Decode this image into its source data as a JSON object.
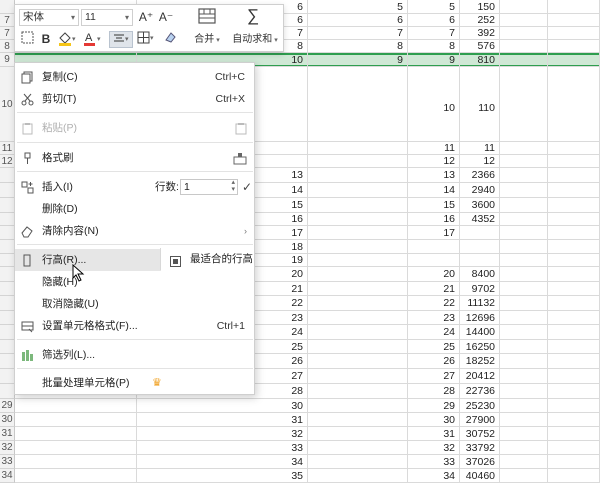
{
  "sheet": {
    "rows": [
      {
        "hdr": "",
        "b": "6",
        "c": "5",
        "d": "5",
        "e": "150"
      },
      {
        "hdr": "7",
        "b": "6",
        "c": "6",
        "d": "6",
        "e": "252"
      },
      {
        "hdr": "7",
        "b": "7",
        "c": "7",
        "d": "7",
        "e": "392"
      },
      {
        "hdr": "8",
        "b": "8",
        "c": "8",
        "d": "8",
        "e": "576"
      },
      {
        "hdr": "9",
        "b": "10",
        "c": "9",
        "d": "9",
        "e": "810"
      },
      {
        "hdr": "10",
        "b": "",
        "c": "",
        "d": "10",
        "e": "110"
      },
      {
        "hdr": "11",
        "b": "",
        "c": "",
        "d": "11",
        "e": "11"
      },
      {
        "hdr": "12",
        "b": "",
        "c": "",
        "d": "12",
        "e": "12"
      },
      {
        "hdr": "",
        "b": "13",
        "c": "",
        "d": "13",
        "e": "2366"
      },
      {
        "hdr": "",
        "b": "14",
        "c": "",
        "d": "14",
        "e": "2940"
      },
      {
        "hdr": "",
        "b": "15",
        "c": "",
        "d": "15",
        "e": "3600"
      },
      {
        "hdr": "",
        "b": "16",
        "c": "",
        "d": "16",
        "e": "4352"
      },
      {
        "hdr": "",
        "b": "17",
        "c": "",
        "d": "17",
        "e": ""
      },
      {
        "hdr": "",
        "b": "18",
        "c": "",
        "d": "",
        "e": ""
      },
      {
        "hdr": "",
        "b": "19",
        "c": "",
        "d": "",
        "e": ""
      },
      {
        "hdr": "",
        "b": "20",
        "c": "",
        "d": "20",
        "e": "8400"
      },
      {
        "hdr": "",
        "b": "21",
        "c": "",
        "d": "21",
        "e": "9702"
      },
      {
        "hdr": "",
        "b": "22",
        "c": "",
        "d": "22",
        "e": "11132"
      },
      {
        "hdr": "",
        "b": "23",
        "c": "",
        "d": "23",
        "e": "12696"
      },
      {
        "hdr": "",
        "b": "24",
        "c": "",
        "d": "24",
        "e": "14400"
      },
      {
        "hdr": "",
        "b": "25",
        "c": "",
        "d": "25",
        "e": "16250"
      },
      {
        "hdr": "",
        "b": "26",
        "c": "",
        "d": "26",
        "e": "18252"
      },
      {
        "hdr": "",
        "b": "27",
        "c": "",
        "d": "27",
        "e": "20412"
      },
      {
        "hdr": "",
        "b": "28",
        "c": "",
        "d": "28",
        "e": "22736"
      },
      {
        "hdr": "29",
        "b": "30",
        "c": "",
        "d": "29",
        "e": "25230"
      },
      {
        "hdr": "30",
        "b": "31",
        "c": "",
        "d": "30",
        "e": "27900"
      },
      {
        "hdr": "31",
        "b": "32",
        "c": "",
        "d": "31",
        "e": "30752"
      },
      {
        "hdr": "32",
        "b": "33",
        "c": "",
        "d": "32",
        "e": "33792"
      },
      {
        "hdr": "33",
        "b": "34",
        "c": "",
        "d": "33",
        "e": "37026"
      },
      {
        "hdr": "34",
        "b": "35",
        "c": "",
        "d": "34",
        "e": "40460"
      }
    ]
  },
  "toolbar": {
    "font_name": "宋体",
    "font_size": "11",
    "grow_font": "A⁺",
    "shrink_font": "A⁻",
    "merge_label": "合并",
    "autosum_label": "自动求和",
    "bold": "B"
  },
  "menu": {
    "copy": {
      "label": "复制(C)",
      "shortcut": "Ctrl+C"
    },
    "cut": {
      "label": "剪切(T)",
      "shortcut": "Ctrl+X"
    },
    "paste": {
      "label": "粘贴(P)"
    },
    "format_painter": {
      "label": "格式刷"
    },
    "insert": {
      "label": "插入(I)",
      "rows_label": "行数:",
      "rows_value": "1"
    },
    "delete": {
      "label": "删除(D)"
    },
    "clear": {
      "label": "清除内容(N)"
    },
    "row_height": {
      "label": "行高(R)..."
    },
    "best_fit": {
      "label": "最适合的行高"
    },
    "hide": {
      "label": "隐藏(H)"
    },
    "unhide": {
      "label": "取消隐藏(U)"
    },
    "format_cells": {
      "label": "设置单元格格式(F)...",
      "shortcut": "Ctrl+1"
    },
    "filter": {
      "label": "筛选列(L)..."
    },
    "batch": {
      "label": "批量处理单元格(P)"
    }
  },
  "colors": {
    "selection_green": "#2e9e4f",
    "font_color_red": "#e53935",
    "highlight_yellow": "#f5c518",
    "crown_orange": "#f0a020"
  }
}
